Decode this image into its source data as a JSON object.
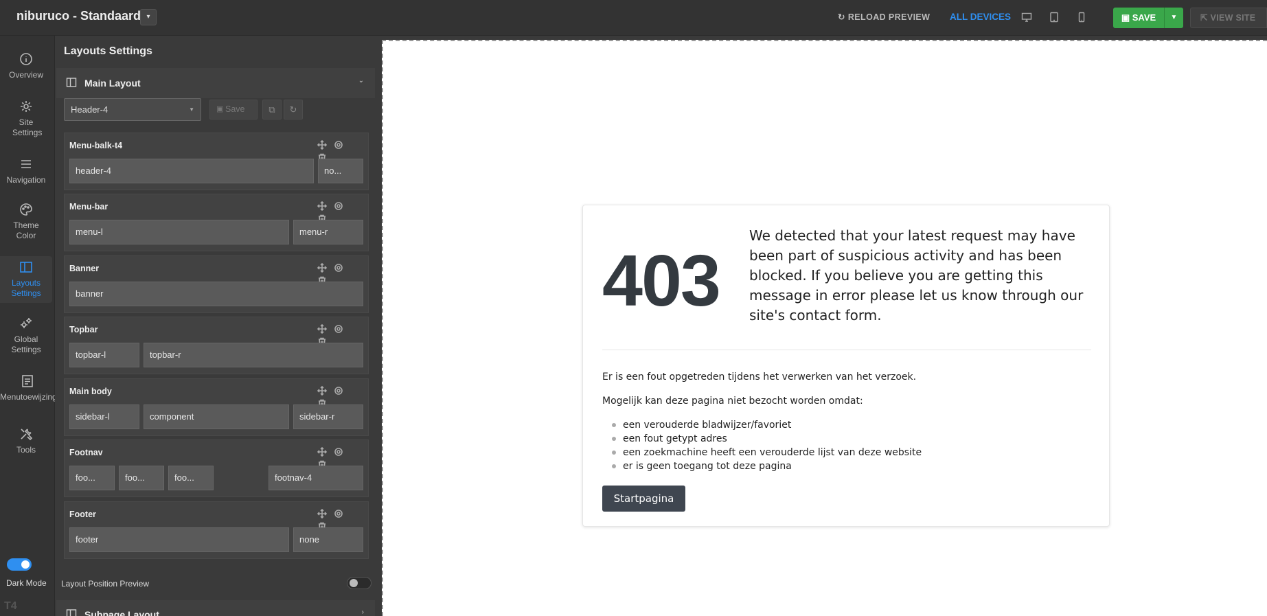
{
  "app": {
    "site_title": "niburuco - Standaard",
    "title_caret": "▾"
  },
  "toolbar": {
    "reload_preview": "RELOAD PREVIEW",
    "all_devices": "ALL DEVICES",
    "save": "SAVE",
    "view_site": "VIEW SITE",
    "active_color": "#2f8ff0",
    "save_color": "#3aa74a"
  },
  "rail": {
    "items": [
      {
        "label": "Overview",
        "icon": "info-icon"
      },
      {
        "label": "Site Settings",
        "icon": "gear-icon"
      },
      {
        "label": "Navigation",
        "icon": "menu-icon"
      },
      {
        "label": "Theme Color",
        "icon": "palette-icon"
      },
      {
        "label": "Layouts Settings",
        "icon": "layout-icon"
      },
      {
        "label": "Global Settings",
        "icon": "gears-icon"
      },
      {
        "label": "Menutoewijzing",
        "icon": "list-icon"
      },
      {
        "label": "Tools",
        "icon": "tools-icon"
      }
    ],
    "dark_mode_label": "Dark Mode",
    "dark_mode_on": true,
    "logo": "T4"
  },
  "panel": {
    "title": "Layouts Settings",
    "main_layout_label": "Main Layout",
    "selected_layout": "Header-4",
    "save_label": "Save",
    "rows": [
      {
        "name": "Menu-balk-t4",
        "cells": [
          "header-4",
          "no..."
        ]
      },
      {
        "name": "Menu-bar",
        "cells": [
          "menu-l",
          "menu-r"
        ]
      },
      {
        "name": "Banner",
        "cells": [
          "banner"
        ]
      },
      {
        "name": "Topbar",
        "cells": [
          "topbar-l",
          "topbar-r"
        ]
      },
      {
        "name": "Main body",
        "cells": [
          "sidebar-l",
          "component",
          "sidebar-r"
        ]
      },
      {
        "name": "Footnav",
        "cells": [
          "foo...",
          "foo...",
          "foo...",
          "footnav-4"
        ]
      },
      {
        "name": "Footer",
        "cells": [
          "footer",
          "none"
        ]
      }
    ],
    "layout_position_preview_label": "Layout Position Preview",
    "layout_position_preview_on": false,
    "subpage_layout_label": "Subpage Layout"
  },
  "preview": {
    "error_code": "403",
    "message": "We detected that your latest request may have been part of suspicious activity and has been blocked. If you believe you are getting this message in error please let us know through our site's contact form.",
    "p1": "Er is een fout opgetreden tijdens het verwerken van het verzoek.",
    "p2": "Mogelijk kan deze pagina niet bezocht worden omdat:",
    "reasons": [
      "een verouderde bladwijzer/favoriet",
      "een fout getypt adres",
      "een zoekmachine heeft een verouderde lijst van deze website",
      "er is geen toegang tot deze pagina"
    ],
    "home_button": "Startpagina"
  }
}
